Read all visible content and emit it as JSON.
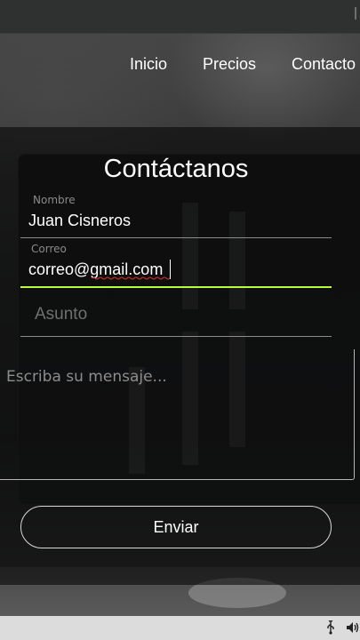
{
  "nav": {
    "items": [
      {
        "label": "Inicio"
      },
      {
        "label": "Precios"
      },
      {
        "label": "Contacto"
      }
    ]
  },
  "form": {
    "title": "Contáctanos",
    "name_field": {
      "label": "Nombre",
      "value": "Juan Cisneros"
    },
    "email_field": {
      "label": "Correo",
      "value": "correo@gmail.com"
    },
    "subject_field": {
      "placeholder": "Asunto"
    },
    "message_field": {
      "placeholder": "Escriba su mensaje..."
    },
    "submit_label": "Enviar"
  },
  "colors": {
    "active_underline": "#b6ff35",
    "spellcheck": "#e0302a"
  },
  "taskbar": {
    "icons": [
      "usb-icon",
      "volume-icon"
    ]
  }
}
